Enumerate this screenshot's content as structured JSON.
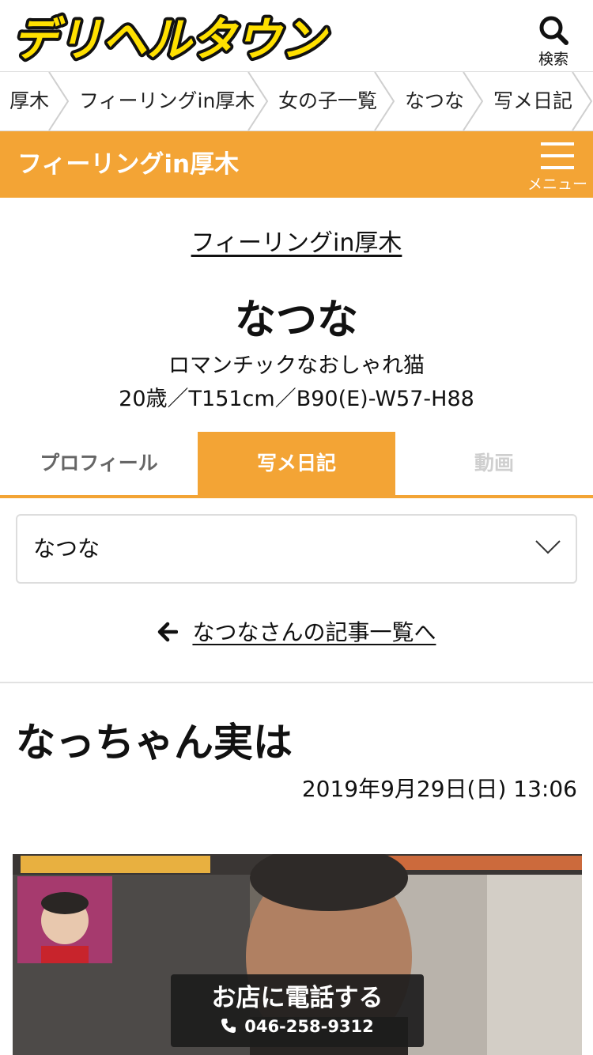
{
  "header": {
    "logo_text": "デリヘルタウン",
    "search_label": "検索"
  },
  "breadcrumb": {
    "items": [
      "厚木",
      "フィーリングin厚木",
      "女の子一覧",
      "なつな",
      "写メ日記"
    ]
  },
  "shop_bar": {
    "shop_name": "フィーリングin厚木",
    "menu_label": "メニュー"
  },
  "profile": {
    "shop_link": "フィーリングin厚木",
    "name": "なつな",
    "catchphrase": "ロマンチックなおしゃれ猫",
    "specs": "20歳／T151cm／B90(E)-W57-H88"
  },
  "tabs": {
    "items": [
      "プロフィール",
      "写メ日記",
      "動画"
    ],
    "active": "写メ日記"
  },
  "select": {
    "value": "なつな"
  },
  "back_link": {
    "label": "なつなさんの記事一覧へ"
  },
  "article": {
    "title": "なっちゃん実は",
    "date": "2019年9月29日(日) 13:06"
  },
  "call_button": {
    "label": "お店に電話する",
    "phone": "046-258-9312"
  },
  "colors": {
    "accent": "#f3a435",
    "logo_yellow": "#ffe000",
    "call_bg": "#1c1c1c"
  }
}
